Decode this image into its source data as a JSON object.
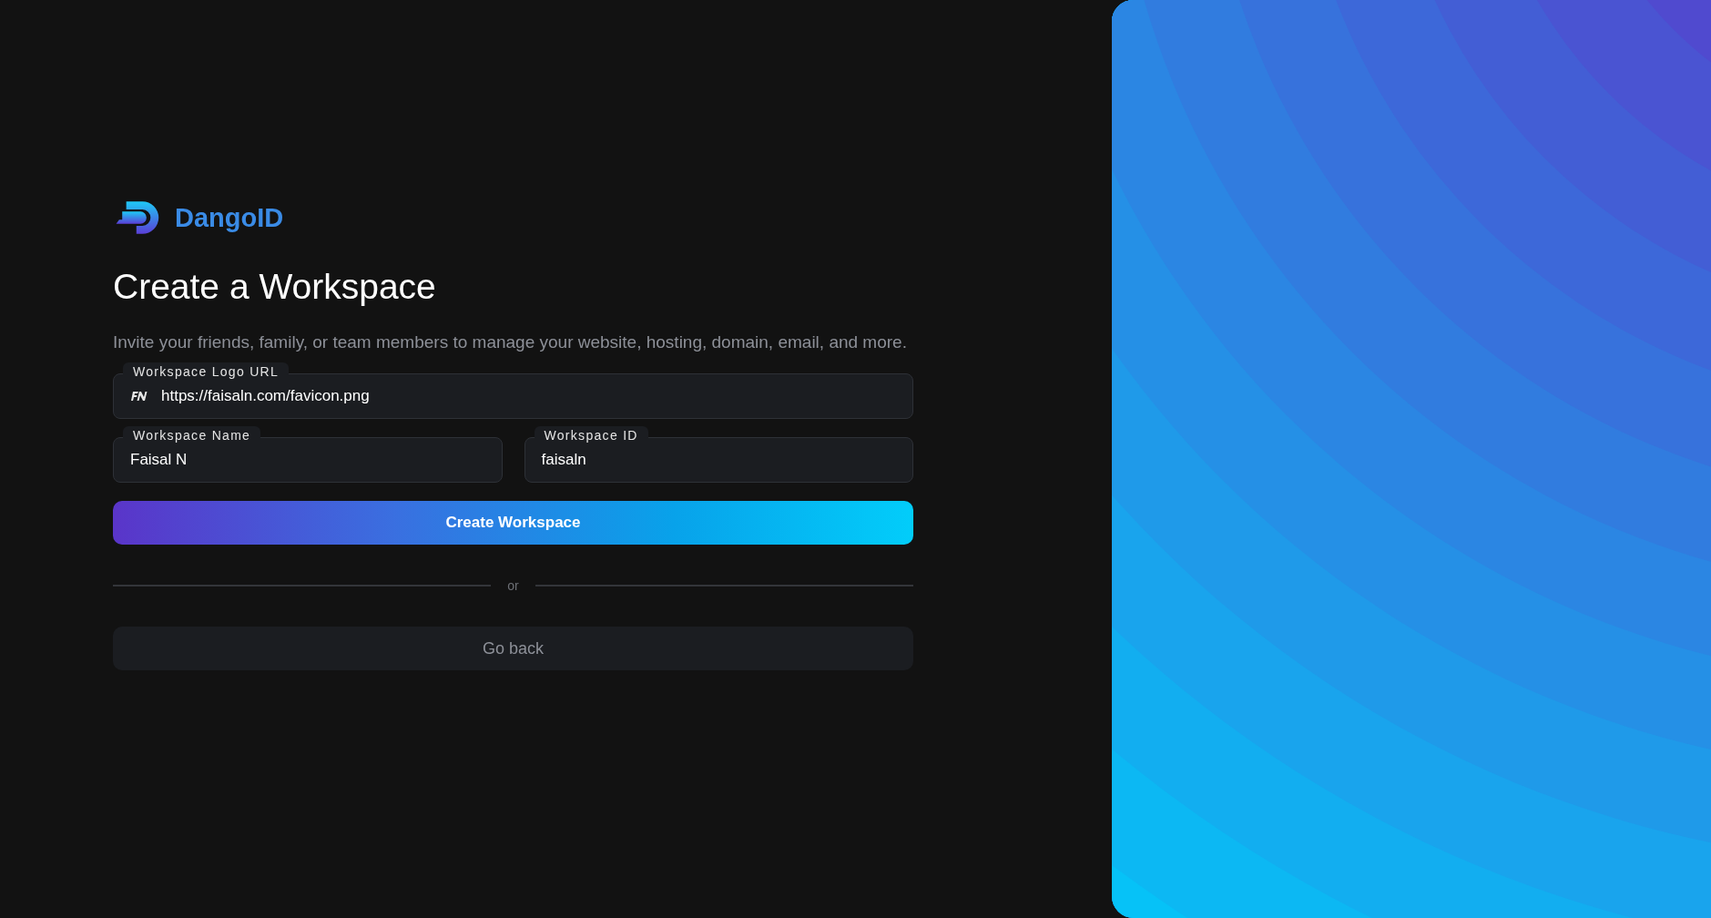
{
  "brand": {
    "name": "DangoID"
  },
  "heading": "Create a Workspace",
  "description": "Invite your friends, family, or team members to manage your website, hosting, domain, email, and more.",
  "fields": [
    {
      "label": "Workspace Logo URL",
      "value": "https://faisaln.com/favicon.png",
      "kind": "logo"
    },
    {
      "label": "Workspace Name",
      "value": "Faisal N",
      "kind": "text"
    },
    {
      "label": "Workspace ID",
      "value": "faisaln",
      "kind": "text"
    }
  ],
  "primary_button": "Create Workspace",
  "divider": "or",
  "secondary_button": "Go back"
}
